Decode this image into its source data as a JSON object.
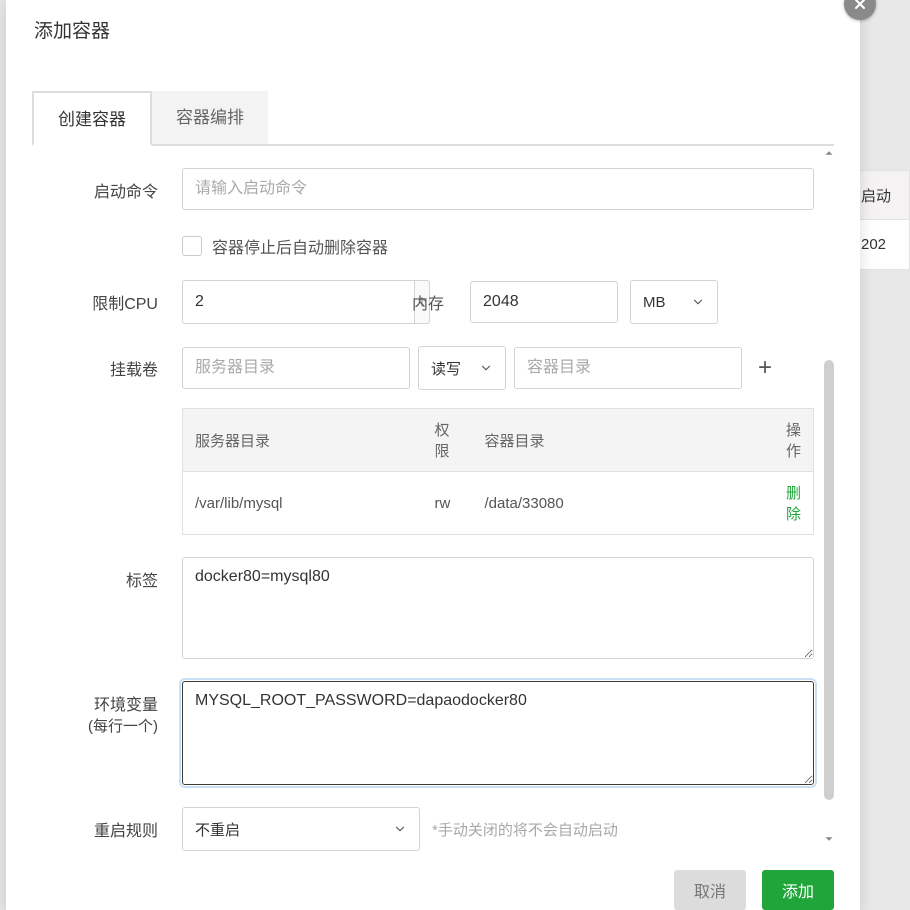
{
  "modal": {
    "title": "添加容器",
    "tabs": {
      "create": "创建容器",
      "compose": "容器编排"
    }
  },
  "bg": {
    "col_header": "启动",
    "cell_value": "202"
  },
  "labels": {
    "start_cmd": "启动命令",
    "cpu": "限制CPU",
    "mem": "内存",
    "mount": "挂载卷",
    "tags": "标签",
    "env": "环境变量",
    "env_sub": "(每行一个)",
    "restart": "重启规则"
  },
  "placeholders": {
    "start_cmd": "请输入启动命令",
    "server_dir": "服务器目录",
    "container_dir": "容器目录"
  },
  "values": {
    "cpu": "2",
    "mem": "2048",
    "mem_unit": "MB",
    "rw": "读写",
    "tags": "docker80=mysql80",
    "env": "MYSQL_ROOT_PASSWORD=dapaodocker80",
    "restart": "不重启"
  },
  "checkbox": {
    "auto_remove": "容器停止后自动删除容器"
  },
  "vol_table": {
    "headers": {
      "server": "服务器目录",
      "perm": "权限",
      "container": "容器目录",
      "op": "操作"
    },
    "row": {
      "server": "/var/lib/mysql",
      "perm": "rw",
      "container": "/data/33080",
      "op": "删除"
    }
  },
  "hints": {
    "restart": "*手动关闭的将不会自动启动"
  },
  "footer": {
    "cancel": "取消",
    "add": "添加"
  },
  "icons": {
    "close": "close-icon",
    "arrow_up": "arrow-up-icon",
    "chevron_down": "chevron-down-icon",
    "plus": "plus-icon"
  }
}
